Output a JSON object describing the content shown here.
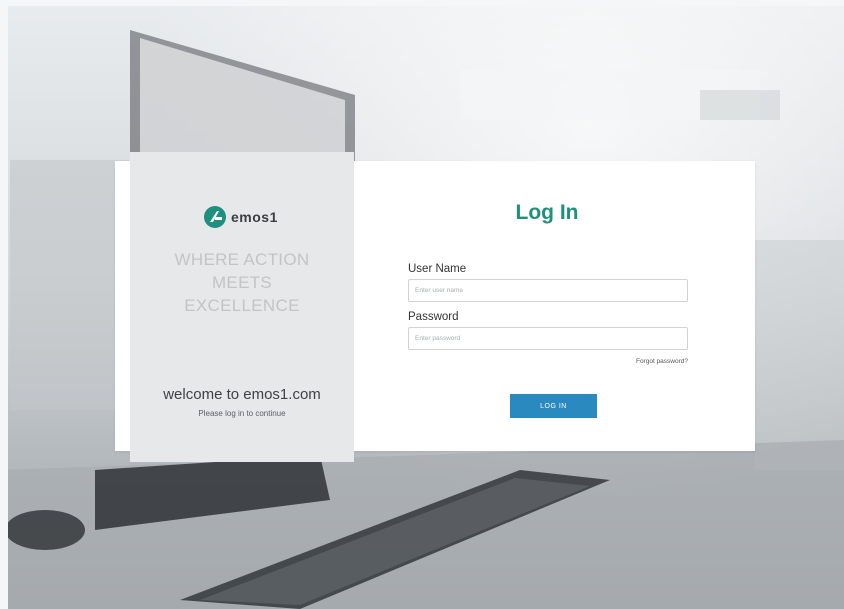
{
  "brand": {
    "name": "emos1",
    "logo_icon": "emos1-logo-icon",
    "accent_color": "#1f8f7e",
    "button_color": "#2a8ac0"
  },
  "left_panel": {
    "tagline_line1": "WHERE ACTION",
    "tagline_line2": "MEETS",
    "tagline_line3": "EXCELLENCE",
    "welcome": "welcome to emos1.com",
    "subtext": "Please log in to continue"
  },
  "login_form": {
    "title": "Log In",
    "username_label": "User Name",
    "username_placeholder": "Enter user name",
    "username_value": "",
    "password_label": "Password",
    "password_placeholder": "Enter password",
    "password_value": "",
    "forgot_password": "Forgot password?",
    "submit_label": "LOG IN"
  }
}
